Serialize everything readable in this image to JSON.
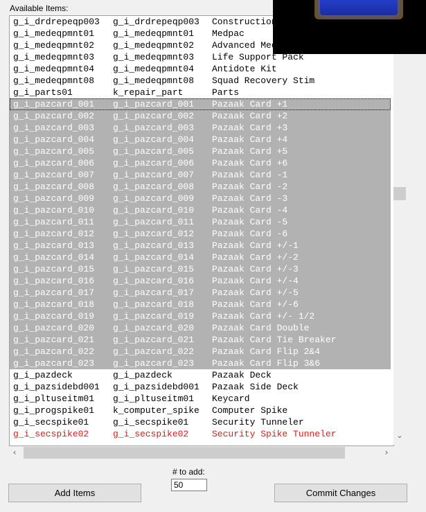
{
  "group_label": "Available Items:",
  "items": [
    {
      "tag": "g_i_drdrepeqp003",
      "resref": "g_i_drdrepeqp003",
      "name": "Construction Kit",
      "state": "normal"
    },
    {
      "tag": "g_i_medeqpmnt01",
      "resref": "g_i_medeqpmnt01",
      "name": "Medpac",
      "state": "normal"
    },
    {
      "tag": "g_i_medeqpmnt02",
      "resref": "g_i_medeqpmnt02",
      "name": "Advanced Medpac",
      "state": "normal"
    },
    {
      "tag": "g_i_medeqpmnt03",
      "resref": "g_i_medeqpmnt03",
      "name": "Life Support Pack",
      "state": "normal"
    },
    {
      "tag": "g_i_medeqpmnt04",
      "resref": "g_i_medeqpmnt04",
      "name": "Antidote Kit",
      "state": "normal"
    },
    {
      "tag": "g_i_medeqpmnt08",
      "resref": "g_i_medeqpmnt08",
      "name": "Squad Recovery Stim",
      "state": "normal"
    },
    {
      "tag": "g_i_parts01",
      "resref": "k_repair_part",
      "name": "Parts",
      "state": "normal"
    },
    {
      "tag": "g_i_pazcard_001",
      "resref": "g_i_pazcard_001",
      "name": "Pazaak Card +1",
      "state": "selected-focused"
    },
    {
      "tag": "g_i_pazcard_002",
      "resref": "g_i_pazcard_002",
      "name": "Pazaak Card +2",
      "state": "selected"
    },
    {
      "tag": "g_i_pazcard_003",
      "resref": "g_i_pazcard_003",
      "name": "Pazaak Card +3",
      "state": "selected"
    },
    {
      "tag": "g_i_pazcard_004",
      "resref": "g_i_pazcard_004",
      "name": "Pazaak Card +4",
      "state": "selected"
    },
    {
      "tag": "g_i_pazcard_005",
      "resref": "g_i_pazcard_005",
      "name": "Pazaak Card +5",
      "state": "selected"
    },
    {
      "tag": "g_i_pazcard_006",
      "resref": "g_i_pazcard_006",
      "name": "Pazaak Card +6",
      "state": "selected"
    },
    {
      "tag": "g_i_pazcard_007",
      "resref": "g_i_pazcard_007",
      "name": "Pazaak Card -1",
      "state": "selected"
    },
    {
      "tag": "g_i_pazcard_008",
      "resref": "g_i_pazcard_008",
      "name": "Pazaak Card -2",
      "state": "selected"
    },
    {
      "tag": "g_i_pazcard_009",
      "resref": "g_i_pazcard_009",
      "name": "Pazaak Card -3",
      "state": "selected"
    },
    {
      "tag": "g_i_pazcard_010",
      "resref": "g_i_pazcard_010",
      "name": "Pazaak Card -4",
      "state": "selected"
    },
    {
      "tag": "g_i_pazcard_011",
      "resref": "g_i_pazcard_011",
      "name": "Pazaak Card -5",
      "state": "selected"
    },
    {
      "tag": "g_i_pazcard_012",
      "resref": "g_i_pazcard_012",
      "name": "Pazaak Card -6",
      "state": "selected"
    },
    {
      "tag": "g_i_pazcard_013",
      "resref": "g_i_pazcard_013",
      "name": "Pazaak Card +/-1",
      "state": "selected"
    },
    {
      "tag": "g_i_pazcard_014",
      "resref": "g_i_pazcard_014",
      "name": "Pazaak Card +/-2",
      "state": "selected"
    },
    {
      "tag": "g_i_pazcard_015",
      "resref": "g_i_pazcard_015",
      "name": "Pazaak Card +/-3",
      "state": "selected"
    },
    {
      "tag": "g_i_pazcard_016",
      "resref": "g_i_pazcard_016",
      "name": "Pazaak Card +/-4",
      "state": "selected"
    },
    {
      "tag": "g_i_pazcard_017",
      "resref": "g_i_pazcard_017",
      "name": "Pazaak Card +/-5",
      "state": "selected"
    },
    {
      "tag": "g_i_pazcard_018",
      "resref": "g_i_pazcard_018",
      "name": "Pazaak Card +/-6",
      "state": "selected"
    },
    {
      "tag": "g_i_pazcard_019",
      "resref": "g_i_pazcard_019",
      "name": "Pazaak Card +/- 1/2",
      "state": "selected"
    },
    {
      "tag": "g_i_pazcard_020",
      "resref": "g_i_pazcard_020",
      "name": "Pazaak Card Double",
      "state": "selected"
    },
    {
      "tag": "g_i_pazcard_021",
      "resref": "g_i_pazcard_021",
      "name": "Pazaak Card Tie Breaker",
      "state": "selected"
    },
    {
      "tag": "g_i_pazcard_022",
      "resref": "g_i_pazcard_022",
      "name": "Pazaak Card Flip 2&4",
      "state": "selected"
    },
    {
      "tag": "g_i_pazcard_023",
      "resref": "g_i_pazcard_023",
      "name": "Pazaak Card Flip 3&6",
      "state": "selected"
    },
    {
      "tag": "g_i_pazdeck",
      "resref": "g_i_pazdeck",
      "name": "Pazaak Deck",
      "state": "normal"
    },
    {
      "tag": "g_i_pazsidebd001",
      "resref": "g_i_pazsidebd001",
      "name": "Pazaak Side Deck",
      "state": "normal"
    },
    {
      "tag": "g_i_pltuseitm01",
      "resref": "g_i_pltuseitm01",
      "name": "Keycard",
      "state": "normal"
    },
    {
      "tag": "g_i_progspike01",
      "resref": "k_computer_spike",
      "name": "Computer Spike",
      "state": "normal"
    },
    {
      "tag": "g_i_secspike01",
      "resref": "g_i_secspike01",
      "name": "Security Tunneler",
      "state": "normal"
    },
    {
      "tag": "g_i_secspike02",
      "resref": "g_i_secspike02",
      "name": "Security Spike Tunneler",
      "state": "red"
    }
  ],
  "quantity": {
    "label": "# to add:",
    "value": "50"
  },
  "buttons": {
    "add": "Add Items",
    "commit": "Commit Changes"
  },
  "icons": {
    "scroll_down": "chevron-down-icon",
    "scroll_left": "chevron-left-icon",
    "scroll_right": "chevron-right-icon"
  },
  "colors": {
    "selection": "#b2b2b2",
    "highlight_text": "#e81818",
    "preview_accent": "#2844d8"
  }
}
